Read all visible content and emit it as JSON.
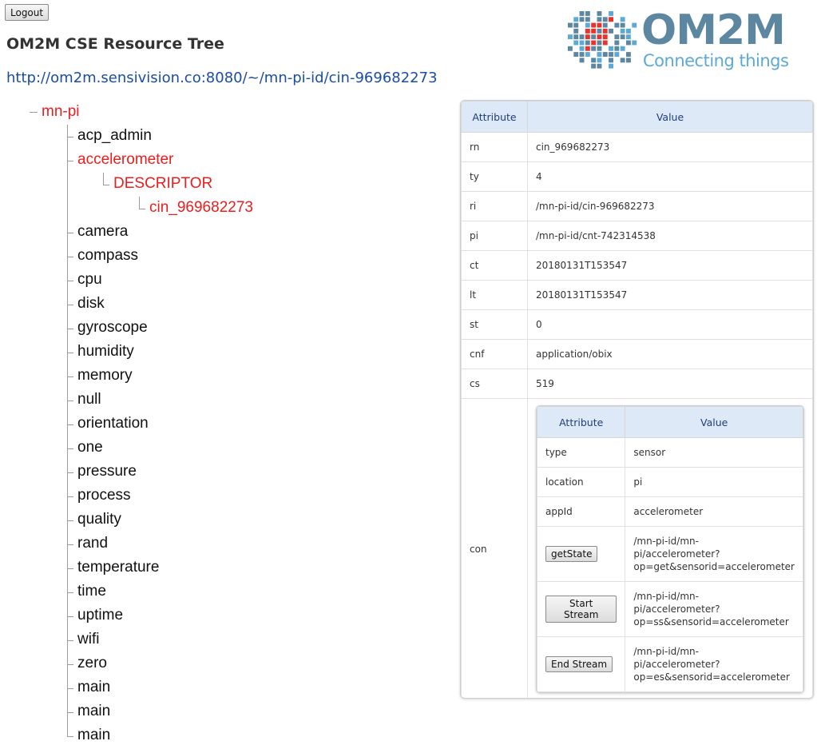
{
  "header": {
    "logout_label": "Logout",
    "page_title": "OM2M CSE Resource Tree",
    "url": "http://om2m.sensivision.co:8080/~/mn-pi-id/cin-969682273"
  },
  "logo": {
    "title": "OM2M",
    "subtitle": "Connecting things",
    "colors": {
      "blue": "#5d87a1",
      "light_blue": "#5da9d6",
      "red": "#e8322b"
    }
  },
  "tree": {
    "root": "mn-pi",
    "children": [
      "acp_admin",
      "accelerometer",
      "camera",
      "compass",
      "cpu",
      "disk",
      "gyroscope",
      "humidity",
      "memory",
      "null",
      "orientation",
      "one",
      "pressure",
      "process",
      "quality",
      "rand",
      "temperature",
      "time",
      "uptime",
      "wifi",
      "zero",
      "main",
      "main",
      "main"
    ],
    "accelerometer_child": "DESCRIPTOR",
    "descriptor_child": "cin_969682273",
    "colors": {
      "selected": "#ee1c1c",
      "normal": "#111111"
    }
  },
  "table": {
    "header": {
      "attribute": "Attribute",
      "value": "Value"
    },
    "rows": [
      {
        "attr": "rn",
        "value": "cin_969682273"
      },
      {
        "attr": "ty",
        "value": "4"
      },
      {
        "attr": "ri",
        "value": "/mn-pi-id/cin-969682273"
      },
      {
        "attr": "pi",
        "value": "/mn-pi-id/cnt-742314538"
      },
      {
        "attr": "ct",
        "value": "20180131T153547"
      },
      {
        "attr": "lt",
        "value": "20180131T153547"
      },
      {
        "attr": "st",
        "value": "0"
      },
      {
        "attr": "cnf",
        "value": "application/obix"
      },
      {
        "attr": "cs",
        "value": "519"
      }
    ],
    "con_label": "con",
    "con": {
      "header": {
        "attribute": "Attribute",
        "value": "Value"
      },
      "rows": [
        {
          "attr": "type",
          "value": "sensor"
        },
        {
          "attr": "location",
          "value": "pi"
        },
        {
          "attr": "appId",
          "value": "accelerometer"
        }
      ],
      "ops": [
        {
          "label": "getState",
          "value_lines": [
            "/mn-pi-id/mn-",
            "pi/accelerometer?",
            "op=get&sensorid=accelerometer"
          ]
        },
        {
          "label": "Start Stream",
          "value_lines": [
            "/mn-pi-id/mn-",
            "pi/accelerometer?",
            "op=ss&sensorid=accelerometer"
          ]
        },
        {
          "label": "End Stream",
          "value_lines": [
            "/mn-pi-id/mn-",
            "pi/accelerometer?",
            "op=es&sensorid=accelerometer"
          ]
        }
      ]
    },
    "header_bg": "#dde9f7"
  }
}
